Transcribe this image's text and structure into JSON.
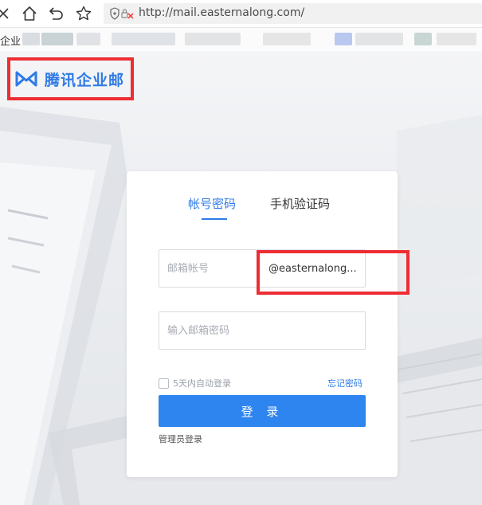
{
  "browser": {
    "url": "http://mail.easternalong.com/",
    "bookmark_text": "企业"
  },
  "logo": {
    "text": "腾讯企业邮"
  },
  "login": {
    "tabs": [
      {
        "label": "帐号密码",
        "active": true
      },
      {
        "label": "手机验证码",
        "active": false
      }
    ],
    "account_placeholder": "邮箱帐号",
    "domain_value": "@easternalong...",
    "password_placeholder": "输入邮箱密码",
    "remember_label": "5天内自动登录",
    "forgot_label": "忘记密码",
    "login_button": "登 录",
    "admin_link": "管理员登录"
  },
  "colors": {
    "brand": "#2f7ae5",
    "button": "#2e85f0",
    "highlight": "#ee2d33"
  }
}
